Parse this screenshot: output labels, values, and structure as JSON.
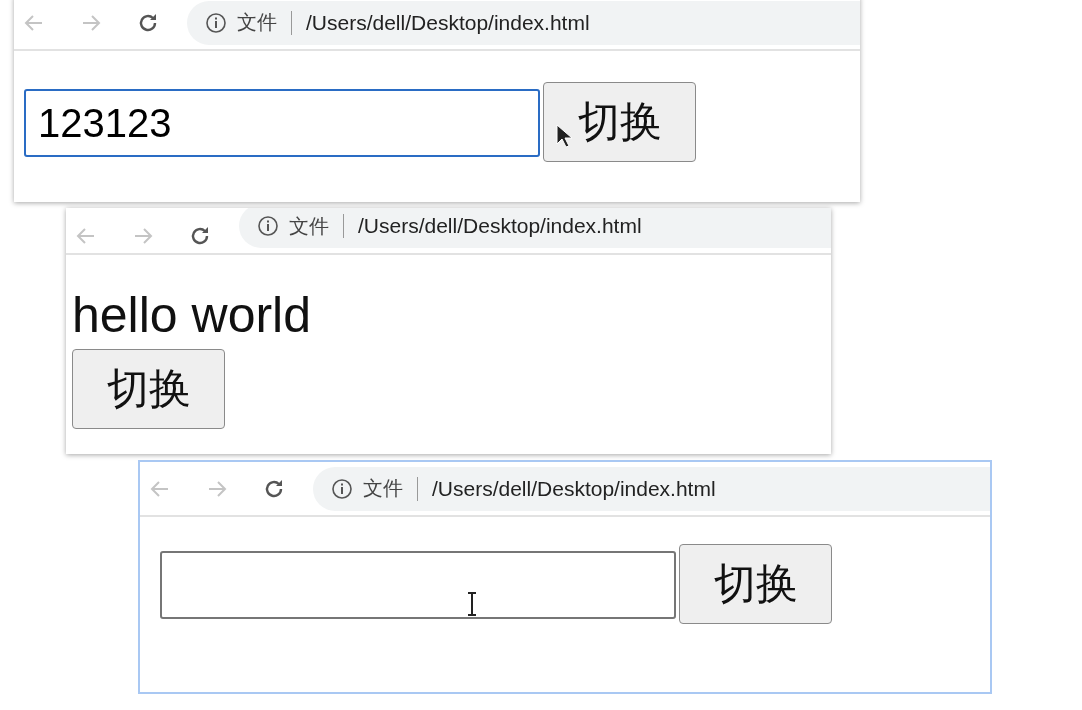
{
  "windows": [
    {
      "active": false,
      "address": {
        "label": "文件",
        "url": "/Users/dell/Desktop/index.html"
      },
      "content": [
        {
          "kind": "input",
          "value": "123123",
          "focused": true
        },
        {
          "kind": "button",
          "label": "切换"
        }
      ],
      "cursor": {
        "kind": "arrow"
      }
    },
    {
      "active": false,
      "address": {
        "label": "文件",
        "url": "/Users/dell/Desktop/index.html"
      },
      "content": [
        {
          "kind": "text",
          "text": "hello world"
        },
        {
          "kind": "button",
          "label": "切换"
        }
      ]
    },
    {
      "active": true,
      "address": {
        "label": "文件",
        "url": "/Users/dell/Desktop/index.html"
      },
      "content": [
        {
          "kind": "input",
          "focused": false
        },
        {
          "kind": "button",
          "label": "切换"
        }
      ],
      "cursor": {
        "kind": "ibeam"
      }
    }
  ]
}
